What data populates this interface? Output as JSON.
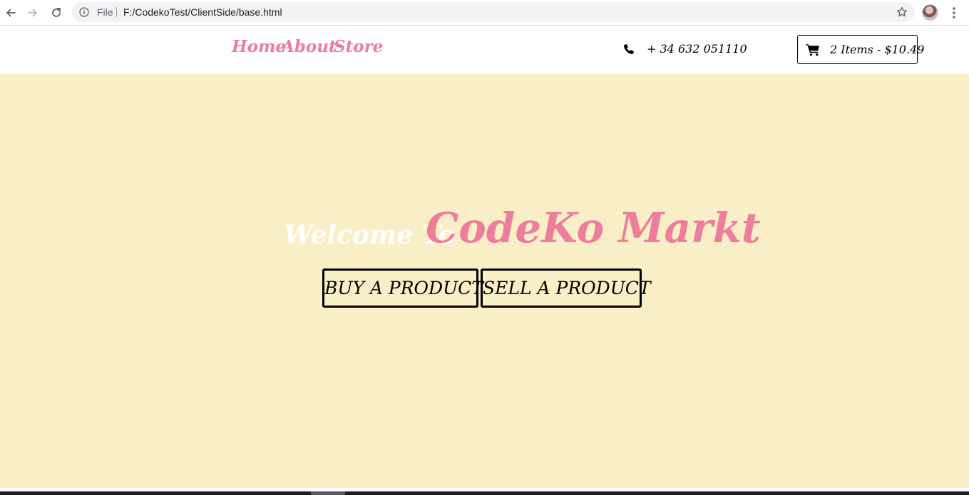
{
  "browser": {
    "scheme_label": "File",
    "url": "F:/CodekoTest/ClientSide/base.html",
    "icons": [
      "back-arrow-icon",
      "forward-arrow-icon",
      "reload-icon",
      "info-icon",
      "star-icon",
      "kebab-menu-icon"
    ]
  },
  "header": {
    "nav": [
      {
        "label": "Home"
      },
      {
        "label": "About"
      },
      {
        "label": "Store"
      }
    ],
    "phone": "+ 34 632 051110",
    "cart_label": "2 Items - $10.49",
    "accent_color": "#ee7c9c"
  },
  "hero": {
    "welcome": "Welcome To",
    "brand": "CodeKo Markt",
    "buy_label": "BUY A PRODUCT",
    "sell_label": "SELL A PRODUCT",
    "background_color": "#f9efc7"
  }
}
